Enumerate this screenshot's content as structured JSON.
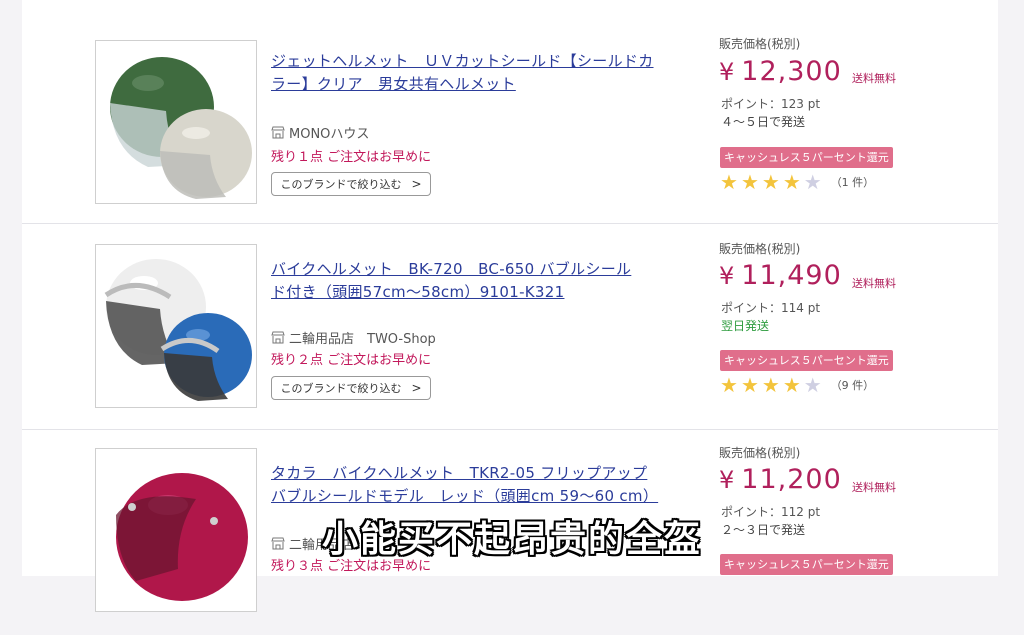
{
  "listings": [
    {
      "title_line1": "ジェットヘルメット　ＵＶカットシールド【シールドカ",
      "title_line2": "ラー】クリア　男女共有ヘルメット",
      "shop": "MONOハウス",
      "stock": "残り１点 ご注文はお早めに",
      "brand_button": "このブランドで絞り込む",
      "price_label": "販売価格(税別)",
      "price_yen": "¥",
      "price": "12,300",
      "shipping": "送料無料",
      "points": "ポイント：123 pt",
      "delivery": "４〜５日で発送",
      "cashless": "キャッシュレス５パーセント還元",
      "rating": 4,
      "review_count": "（1 件）",
      "colors": [
        "#3f6b3f",
        "#d8d6cc"
      ]
    },
    {
      "title_line1": "バイクヘルメット　BK-720　BC-650 バブルシール",
      "title_line2": "ド付き（頭囲57cm～58cm）9101-K321",
      "shop": "二輪用品店　TWO-Shop",
      "stock": "残り２点 ご注文はお早めに",
      "brand_button": "このブランドで絞り込む",
      "price_label": "販売価格(税別)",
      "price_yen": "¥",
      "price": "11,490",
      "shipping": "送料無料",
      "points": "ポイント：114 pt",
      "delivery": "翌日発送",
      "cashless": "キャッシュレス５パーセント還元",
      "rating": 4,
      "review_count": "（9 件）",
      "colors": [
        "#eeeeee",
        "#2a6bb8"
      ]
    },
    {
      "title_line1": "タカラ　バイクヘルメット　TKR2-05 フリップアップ",
      "title_line2": "バブルシールドモデル　レッド（頭囲cm 59～60 cm）",
      "shop": "二輪用品店",
      "stock": "残り３点 ご注文はお早めに",
      "price_label": "販売価格(税別)",
      "price_yen": "¥",
      "price": "11,200",
      "shipping": "送料無料",
      "points": "ポイント：112 pt",
      "delivery": "２〜３日で発送",
      "cashless": "キャッシュレス５パーセント還元",
      "colors": [
        "#b0174a"
      ]
    }
  ],
  "subtitle": "小能买不起昂贵的全盔"
}
